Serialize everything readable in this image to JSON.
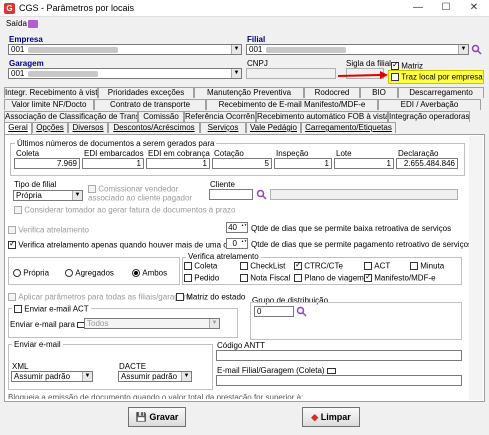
{
  "window": {
    "title": "CGS - Parâmetros por locais",
    "minimize": "—",
    "maximize": "☐",
    "close": "✕"
  },
  "menubar": {
    "exit_label": "Saída"
  },
  "top": {
    "empresa_label": "Empresa",
    "empresa_value": "001",
    "filial_label": "Filial",
    "filial_value": "001",
    "garagem_label": "Garagem",
    "garagem_value": "001",
    "cnpj_label": "CNPJ",
    "sigla_label": "Sigla da filial",
    "matriz_label": "Matriz",
    "traz_local_label": "Traz local por empresa"
  },
  "tabs_row1": [
    "Integr. Recebimento à vista",
    "Prioridades exceções",
    "Manutenção Preventiva",
    "Rodocred",
    "BIO",
    "Descarregamento"
  ],
  "tabs_row2": [
    "Valor limite NF/Docto",
    "Contrato de transporte",
    "Recebimento de E-mail Manifesto/MDF-e",
    "EDI / Averbação"
  ],
  "tabs_row3": [
    "Associação de Classificação de Transporte",
    "Comissão",
    "Referência Ocorrência",
    "Recebimento automático FOB à vista",
    "Integração operadoras"
  ],
  "tabs_row4": [
    "Geral",
    "Opções",
    "Diversos",
    "Descontos/Acréscimos",
    "Serviços",
    "Vale Pedágio",
    "Carregamento/Etiquetas"
  ],
  "geral": {
    "numeros_title": "Últimos números de documentos a serem gerados para",
    "coleta_label": "Coleta",
    "coleta_value": "7.969",
    "edi_emb_label": "EDI embarcados",
    "edi_emb_value": "1",
    "edi_cob_label": "EDI em cobrança",
    "edi_cob_value": "1",
    "cotacao_label": "Cotação",
    "cotacao_value": "5",
    "inspecao_label": "Inspeção",
    "inspecao_value": "1",
    "lote_label": "Lote",
    "lote_value": "1",
    "declaracao_label": "Declaração",
    "declaracao_value": "2.655.484.846",
    "tipo_filial_label": "Tipo de filial",
    "tipo_filial_value": "Própria",
    "comissionar_label": "Comissionar vendedor associado ao cliente pagador",
    "cliente_label": "Cliente",
    "considerar_label": "Considerar tomador ao gerar fatura de documentos à prazo",
    "verifica_atrel_label": "Verifica atrelamento",
    "baixa_days": "40",
    "baixa_label": "Qtde de dias que se permite baixa retroativa de serviços",
    "verifica_carreta_label": "Verifica atrelamento apenas quando houver mais de uma carreta",
    "pag_days": "0",
    "pag_label": "Qtde de dias que se permite pagamento retroativo de serviços",
    "radio_propria": "Própria",
    "radio_agregados": "Agregados",
    "radio_ambos": "Ambos",
    "verifica_group_title": "Verifica atrelamento",
    "va_coleta": "Coleta",
    "va_checklist": "CheckList",
    "va_ctrc": "CTRC/CTe",
    "va_act": "ACT",
    "va_minuta": "Minuta",
    "va_pedido": "Pedido",
    "va_nota": "Nota Fiscal",
    "va_plano": "Plano de viagem",
    "va_manifesto": "Manifesto/MDF-e",
    "aplicar_label": "Aplicar parâmetros para todas as filiais/garagens",
    "matriz_estado_label": "Matriz do estado",
    "enviar_act_label": "Enviar e-mail ACT",
    "enviar_email_para_label": "Enviar e-mail para",
    "todos_value": "Todos",
    "grupo_label": "Grupo de distribuição",
    "grupo_value": "0",
    "enviar_email_title": "Enviar e-mail",
    "xml_label": "XML",
    "xml_value": "Assumir padrão",
    "dacte_label": "DACTE",
    "dacte_value": "Assumir padrão",
    "antt_label": "Código ANTT",
    "email_filial_label": "E-mail Filial/Garagem (Coleta)",
    "bottom_cut_text": "Bloqueia a emissão de documento quando o valor total da prestação for superior à:"
  },
  "buttons": {
    "gravar": "Gravar",
    "limpar": "Limpar"
  },
  "colors": {
    "highlight": "#ffff44",
    "arrow": "#e00000",
    "label_blue": "#000080"
  }
}
